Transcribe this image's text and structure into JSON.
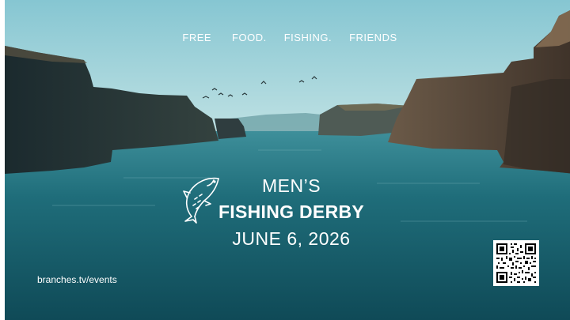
{
  "tagline": {
    "word1": "FREE",
    "word2": "FOOD.",
    "word3": "FISHING.",
    "word4": "FRIENDS"
  },
  "event": {
    "line1": "MEN’S",
    "line2": "FISHING DERBY",
    "date": "JUNE 6, 2026"
  },
  "footer": {
    "url": "branches.tv/events"
  },
  "icons": {
    "fish": "fish-icon",
    "qr": "qr-code"
  },
  "colors": {
    "sky": "#8fcbd6",
    "water": "#1f6b78",
    "text": "#ffffff"
  }
}
